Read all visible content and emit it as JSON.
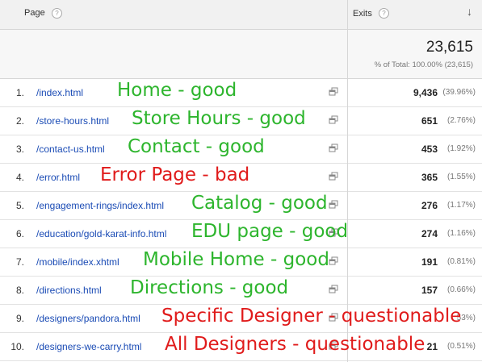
{
  "header": {
    "page_label": "Page",
    "exits_label": "Exits",
    "help_glyph": "?",
    "sort_glyph": "↓"
  },
  "totals": {
    "value": "23,615",
    "sub": "% of Total: 100.00% (23,615)"
  },
  "colors": {
    "good": "#2db52d",
    "bad": "#e01b1b",
    "link": "#1a4bb5"
  },
  "rows": [
    {
      "rank": "1.",
      "page": "/index.html",
      "exits": "9,436",
      "pct": "(39.96%)",
      "note": "Home - good",
      "verdict": "good"
    },
    {
      "rank": "2.",
      "page": "/store-hours.html",
      "exits": "651",
      "pct": "(2.76%)",
      "note": "Store Hours - good",
      "verdict": "good"
    },
    {
      "rank": "3.",
      "page": "/contact-us.html",
      "exits": "453",
      "pct": "(1.92%)",
      "note": "Contact - good",
      "verdict": "good"
    },
    {
      "rank": "4.",
      "page": "/error.html",
      "exits": "365",
      "pct": "(1.55%)",
      "note": "Error Page - bad",
      "verdict": "bad"
    },
    {
      "rank": "5.",
      "page": "/engagement-rings/index.html",
      "exits": "276",
      "pct": "(1.17%)",
      "note": "Catalog - good",
      "verdict": "good"
    },
    {
      "rank": "6.",
      "page": "/education/gold-karat-info.html",
      "exits": "274",
      "pct": "(1.16%)",
      "note": "EDU page - good",
      "verdict": "good"
    },
    {
      "rank": "7.",
      "page": "/mobile/index.xhtml",
      "exits": "191",
      "pct": "(0.81%)",
      "note": "Mobile Home - good",
      "verdict": "good"
    },
    {
      "rank": "8.",
      "page": "/directions.html",
      "exits": "157",
      "pct": "(0.66%)",
      "note": "Directions - good",
      "verdict": "good"
    },
    {
      "rank": "9.",
      "page": "/designers/pandora.html",
      "exits": "",
      "pct": "53%)",
      "note": "Specific Designer - questionable",
      "verdict": "bad"
    },
    {
      "rank": "10.",
      "page": "/designers-we-carry.html",
      "exits": "21",
      "pct": "(0.51%)",
      "note": "All Designers - questionable",
      "verdict": "bad"
    }
  ]
}
